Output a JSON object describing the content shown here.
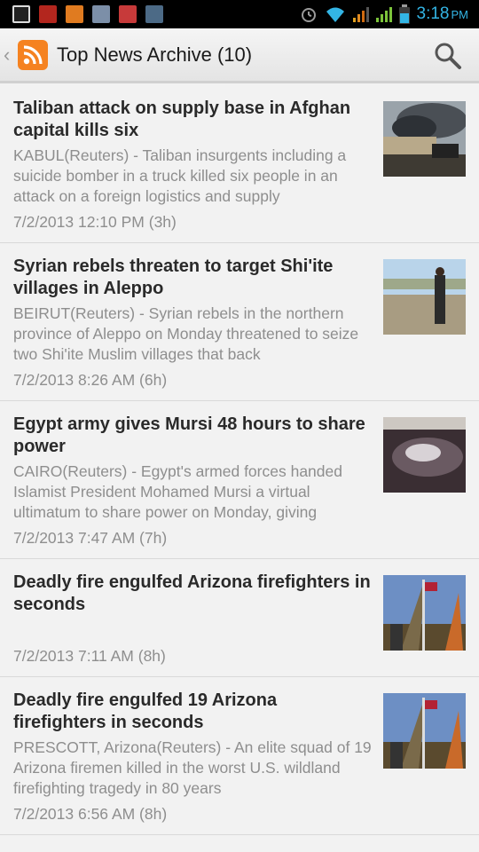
{
  "status_bar": {
    "time": "3:18",
    "ampm": "PM"
  },
  "action_bar": {
    "title": "Top News Archive (10)",
    "back_icon": "chevron-left-icon",
    "logo_icon": "rss-icon",
    "search_icon": "search-icon"
  },
  "articles": [
    {
      "title": "Taliban attack on supply base in Afghan capital kills six",
      "summary": "KABUL(Reuters) - Taliban insurgents including a suicide bomber in a truck killed six people in an attack on a foreign logistics and supply",
      "date": "7/2/2013 12:10 PM (3h)"
    },
    {
      "title": "Syrian rebels threaten to target Shi'ite villages in Aleppo",
      "summary": "BEIRUT(Reuters) - Syrian rebels in the northern province of Aleppo on Monday threatened to seize two Shi'ite Muslim villages that back",
      "date": "7/2/2013 8:26 AM (6h)"
    },
    {
      "title": "Egypt army gives Mursi 48 hours to share power",
      "summary": "CAIRO(Reuters) - Egypt's armed forces handed Islamist President Mohamed Mursi a virtual ultimatum to share power on Monday, giving",
      "date": "7/2/2013 7:47 AM (7h)"
    },
    {
      "title": "Deadly fire engulfed Arizona firefighters in seconds",
      "summary": "",
      "date": "7/2/2013 7:11 AM (8h)"
    },
    {
      "title": "Deadly fire engulfed 19 Arizona firefighters in seconds",
      "summary": "PRESCOTT, Arizona(Reuters) - An elite squad of 19 Arizona firemen killed in the worst U.S. wildland firefighting tragedy in 80 years",
      "date": "7/2/2013 6:56 AM (8h)"
    }
  ]
}
